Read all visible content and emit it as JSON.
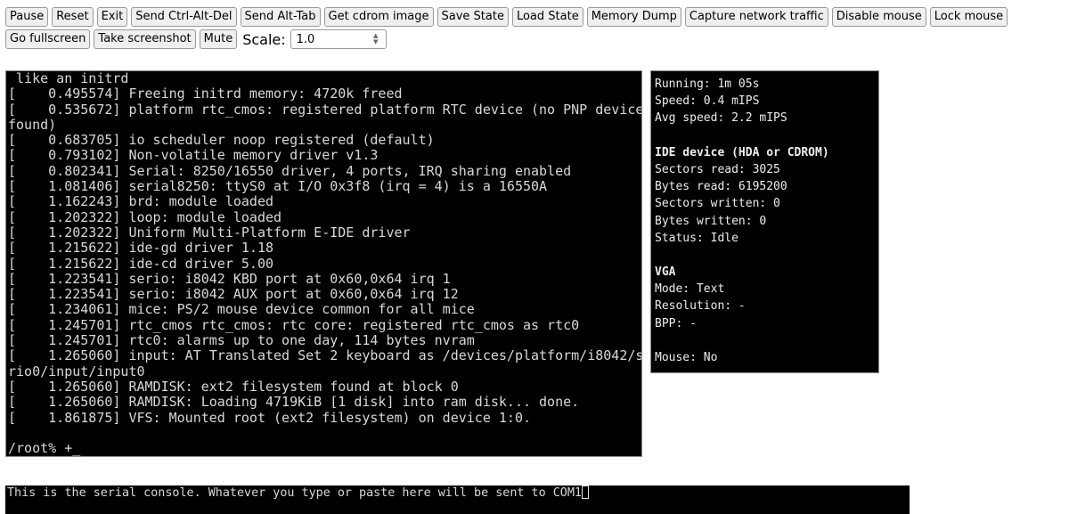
{
  "toolbar": {
    "buttons": [
      "Pause",
      "Reset",
      "Exit",
      "Send Ctrl-Alt-Del",
      "Send Alt-Tab",
      "Get cdrom image",
      "Save State",
      "Load State",
      "Memory Dump",
      "Capture network traffic",
      "Disable mouse",
      "Lock mouse",
      "Go fullscreen",
      "Take screenshot",
      "Mute"
    ],
    "scale_label": "Scale:",
    "scale_value": "1.0"
  },
  "screen": {
    "lines": [
      " like an initrd",
      "[    0.495574] Freeing initrd memory: 4720k freed",
      "[    0.535672] platform rtc_cmos: registered platform RTC device (no PNP device",
      "found)",
      "[    0.683705] io scheduler noop registered (default)",
      "[    0.793102] Non-volatile memory driver v1.3",
      "[    0.802341] Serial: 8250/16550 driver, 4 ports, IRQ sharing enabled",
      "[    1.081406] serial8250: ttyS0 at I/O 0x3f8 (irq = 4) is a 16550A",
      "[    1.162243] brd: module loaded",
      "[    1.202322] loop: module loaded",
      "[    1.202322] Uniform Multi-Platform E-IDE driver",
      "[    1.215622] ide-gd driver 1.18",
      "[    1.215622] ide-cd driver 5.00",
      "[    1.223541] serio: i8042 KBD port at 0x60,0x64 irq 1",
      "[    1.223541] serio: i8042 AUX port at 0x60,0x64 irq 12",
      "[    1.234061] mice: PS/2 mouse device common for all mice",
      "[    1.245701] rtc_cmos rtc_cmos: rtc core: registered rtc_cmos as rtc0",
      "[    1.245701] rtc0: alarms up to one day, 114 bytes nvram",
      "[    1.265060] input: AT Translated Set 2 keyboard as /devices/platform/i8042/se",
      "rio0/input/input0",
      "[    1.265060] RAMDISK: ext2 filesystem found at block 0",
      "[    1.265060] RAMDISK: Loading 4719KiB [1 disk] into ram disk... done.",
      "[    1.861875] VFS: Mounted root (ext2 filesystem) on device 1:0.",
      "",
      "/root% +_"
    ]
  },
  "stats": {
    "running": "Running: 1m 05s",
    "speed": "Speed: 0.4 mIPS",
    "avg_speed": "Avg speed: 2.2 mIPS",
    "ide_title": "IDE device (HDA or CDROM)",
    "sectors_read": "Sectors read: 3025",
    "bytes_read": "Bytes read: 6195200",
    "sectors_written": "Sectors written: 0",
    "bytes_written": "Bytes written: 0",
    "status": "Status: Idle",
    "vga_title": "VGA",
    "mode": "Mode: Text",
    "resolution": "Resolution: -",
    "bpp": "BPP: -",
    "mouse": "Mouse: No"
  },
  "serial": {
    "text": "This is the serial console. Whatever you type or paste here will be sent to COM1"
  }
}
